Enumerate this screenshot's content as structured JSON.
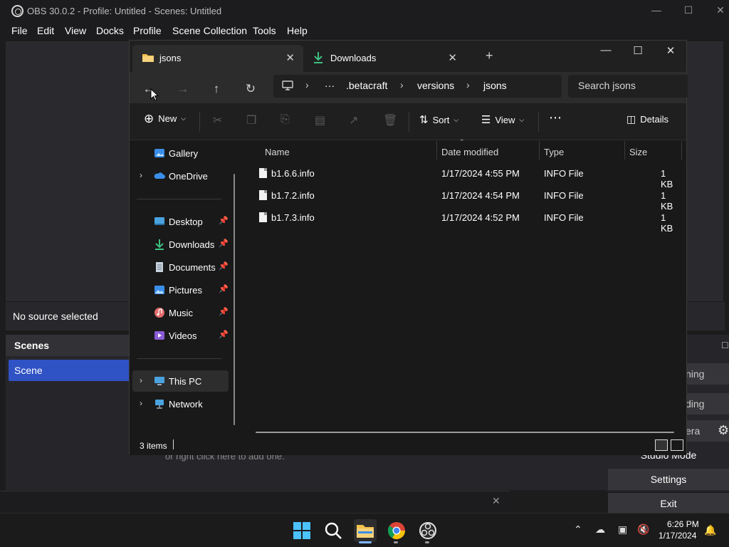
{
  "obs": {
    "title": "OBS 30.0.2 - Profile: Untitled - Scenes: Untitled",
    "menu": [
      "File",
      "Edit",
      "View",
      "Docks",
      "Profile",
      "Scene Collection",
      "Tools",
      "Help"
    ],
    "no_source": "No source selected",
    "scenes_title": "Scenes",
    "scene_item": "Scene",
    "sources_hint": "or right click here to add one.",
    "controls": {
      "streaming_partial": "ning",
      "recording_partial": "ding",
      "virtualcam_partial": "era",
      "studio_mode": "Studio Mode",
      "settings": "Settings",
      "exit": "Exit"
    }
  },
  "explorer": {
    "tabs": [
      {
        "label": "jsons",
        "icon": "folder-icon"
      },
      {
        "label": "Downloads",
        "icon": "download-icon"
      }
    ],
    "breadcrumbs": [
      "···",
      ".betacraft",
      "versions",
      "jsons"
    ],
    "search_placeholder": "Search jsons",
    "toolbar": {
      "new": "New",
      "sort": "Sort",
      "view": "View",
      "details": "Details"
    },
    "nav_items": {
      "gallery": "Gallery",
      "onedrive": "OneDrive",
      "desktop": "Desktop",
      "downloads": "Downloads",
      "documents": "Documents",
      "pictures": "Pictures",
      "music": "Music",
      "videos": "Videos",
      "this_pc": "This PC",
      "network": "Network"
    },
    "columns": {
      "name": "Name",
      "date": "Date modified",
      "type": "Type",
      "size": "Size"
    },
    "files": [
      {
        "name": "b1.6.6.info",
        "date": "1/17/2024 4:55 PM",
        "type": "INFO File",
        "size": "1 KB"
      },
      {
        "name": "b1.7.2.info",
        "date": "1/17/2024 4:54 PM",
        "type": "INFO File",
        "size": "1 KB"
      },
      {
        "name": "b1.7.3.info",
        "date": "1/17/2024 4:52 PM",
        "type": "INFO File",
        "size": "1 KB"
      }
    ],
    "status": "3 items"
  },
  "taskbar": {
    "time": "6:26 PM",
    "date": "1/17/2024"
  },
  "colors": {
    "accent_blue": "#2f52c4",
    "explorer_bg": "#191919",
    "folder_yellow": "#f2c14e",
    "download_green": "#3fbf7f"
  }
}
